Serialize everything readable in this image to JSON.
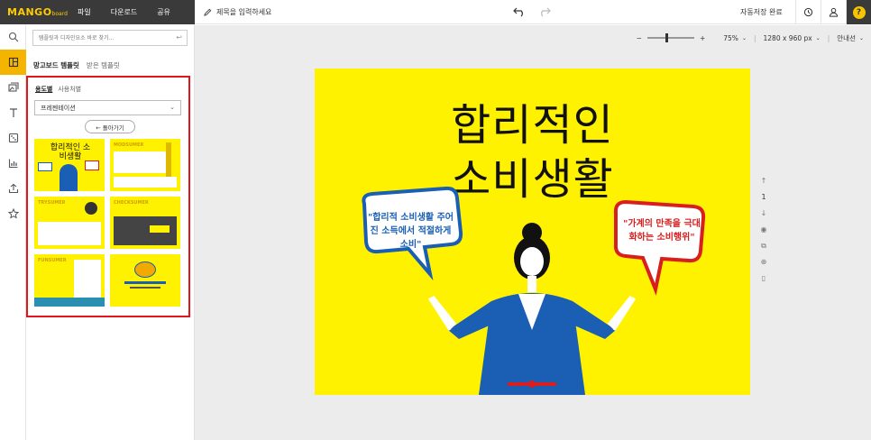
{
  "brand": {
    "logo_main": "MANGO",
    "logo_sub": "board"
  },
  "menu": [
    "파일",
    "다운로드",
    "공유"
  ],
  "toolbar": {
    "title_placeholder": "제목을 입력하세요",
    "autosave": "자동저장 완료"
  },
  "search": {
    "placeholder": "템플릿과 디자인요소 바로 찾기..."
  },
  "panel": {
    "tabs": [
      "망고보드 템플릿",
      "받은 템플릿"
    ],
    "subtabs": [
      "용도별",
      "사용처별"
    ],
    "select_value": "프레젠테이션",
    "back_label": "← 돌아가기",
    "thumbs": [
      {
        "title": "합리적인 소비생활"
      },
      {
        "title": "MODSUMER"
      },
      {
        "title": "TRYSUMER"
      },
      {
        "title": "CHECKSUMER"
      },
      {
        "title": "FUNSUMER"
      },
      {
        "title": ""
      }
    ]
  },
  "zoom": {
    "minus": "−",
    "plus": "+",
    "level": "75%",
    "size": "1280 x 960 px",
    "guide": "안내선"
  },
  "artboard": {
    "title_line1": "합리적인",
    "title_line2": "소비생활",
    "bubble_left": "\"합리적 소비생활 주어진 소득에서 적절하게 소비\"",
    "bubble_right": "\"가계의 만족을 극대화하는 소비행위\""
  },
  "page_nav": {
    "page_number": "1"
  },
  "colors": {
    "accent": "#f5b400",
    "canvas_yellow": "#fff200",
    "highlight": "#e0161b",
    "dark_bar": "#3a3a3a"
  }
}
